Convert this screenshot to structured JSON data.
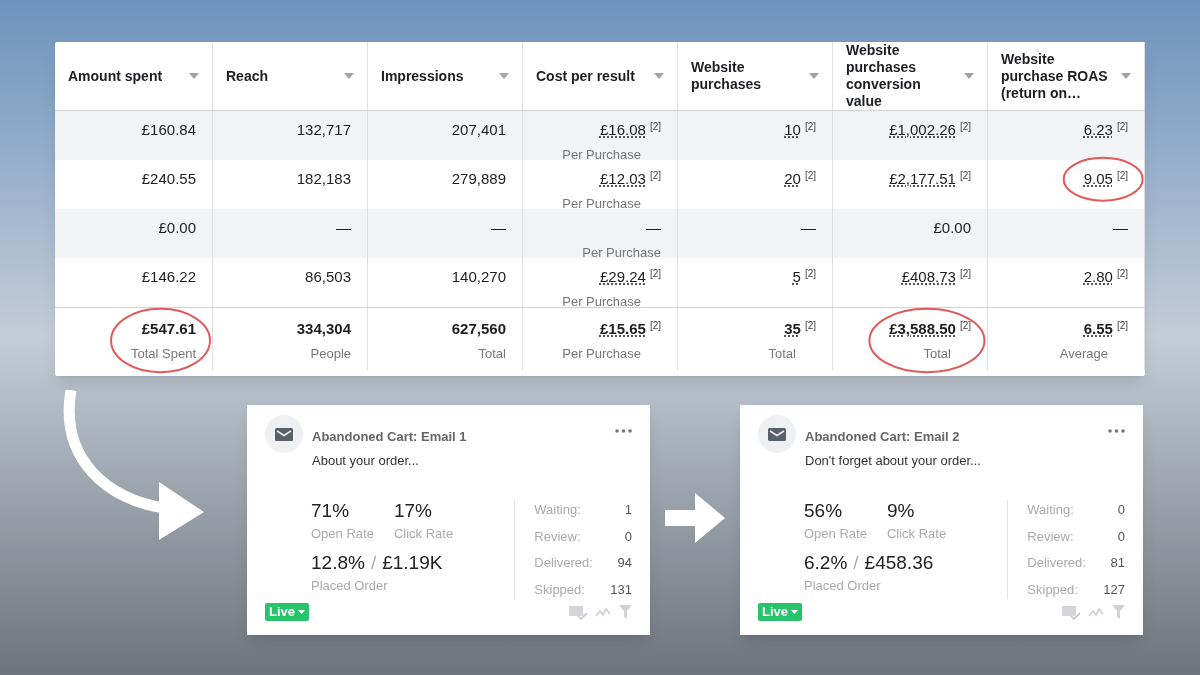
{
  "table": {
    "columns": [
      "Amount spent",
      "Reach",
      "Impressions",
      "Cost per result",
      "Website purchases",
      "Website purchases conversion value",
      "Website purchase ROAS (return on…"
    ],
    "rows": [
      {
        "cells": [
          {
            "value": "£160.84",
            "circled": false
          },
          {
            "value": "132,717",
            "circled": false
          },
          {
            "value": "207,401",
            "circled": false
          },
          {
            "value": "£16.08",
            "note": "[2]",
            "sub": "Per Purchase",
            "circled": false
          },
          {
            "value": "10",
            "note": "[2]",
            "circled": false
          },
          {
            "value": "£1,002.26",
            "note": "[2]",
            "circled": false
          },
          {
            "value": "6.23",
            "note": "[2]",
            "circled": false
          }
        ]
      },
      {
        "cells": [
          {
            "value": "£240.55",
            "circled": false
          },
          {
            "value": "182,183",
            "circled": false
          },
          {
            "value": "279,889",
            "circled": false
          },
          {
            "value": "£12.03",
            "note": "[2]",
            "sub": "Per Purchase",
            "circled": false
          },
          {
            "value": "20",
            "note": "[2]",
            "circled": false
          },
          {
            "value": "£2,177.51",
            "note": "[2]",
            "circled": false
          },
          {
            "value": "9.05",
            "note": "[2]",
            "circled": true
          }
        ]
      },
      {
        "cells": [
          {
            "value": "£0.00",
            "circled": false
          },
          {
            "value": "—",
            "circled": false
          },
          {
            "value": "—",
            "circled": false
          },
          {
            "value": "—",
            "sub": "Per Purchase",
            "circled": false
          },
          {
            "value": "—",
            "circled": false
          },
          {
            "value": "£0.00",
            "circled": false
          },
          {
            "value": "—",
            "circled": false
          }
        ]
      },
      {
        "cells": [
          {
            "value": "£146.22",
            "circled": false
          },
          {
            "value": "86,503",
            "circled": false
          },
          {
            "value": "140,270",
            "circled": false
          },
          {
            "value": "£29.24",
            "note": "[2]",
            "sub": "Per Purchase",
            "circled": false
          },
          {
            "value": "5",
            "note": "[2]",
            "circled": false
          },
          {
            "value": "£408.73",
            "note": "[2]",
            "circled": false
          },
          {
            "value": "2.80",
            "note": "[2]",
            "circled": false
          }
        ]
      }
    ],
    "totals": [
      {
        "value": "£547.61",
        "sub": "Total Spent",
        "circled": true
      },
      {
        "value": "334,304",
        "sub": "People",
        "circled": false
      },
      {
        "value": "627,560",
        "sub": "Total",
        "circled": false
      },
      {
        "value": "£15.65",
        "note": "[2]",
        "sub": "Per Purchase",
        "circled": false
      },
      {
        "value": "35",
        "note": "[2]",
        "sub": "Total",
        "circled": false
      },
      {
        "value": "£3,588.50",
        "note": "[2]",
        "sub": "Total",
        "circled": true
      },
      {
        "value": "6.55",
        "note": "[2]",
        "sub": "Average",
        "circled": false
      }
    ]
  },
  "cards": [
    {
      "title": "Abandoned Cart: Email 1",
      "subject": "About your order...",
      "open_rate": {
        "value": "71%",
        "label": "Open Rate"
      },
      "click_rate": {
        "value": "17%",
        "label": "Click Rate"
      },
      "placed_order": {
        "rate": "12.8%",
        "separator": "/",
        "revenue": "£1.19K",
        "label": "Placed Order"
      },
      "counts": [
        {
          "label": "Waiting:",
          "value": "1"
        },
        {
          "label": "Review:",
          "value": "0"
        },
        {
          "label": "Delivered:",
          "value": "94"
        },
        {
          "label": "Skipped:",
          "value": "131"
        }
      ],
      "status": "Live"
    },
    {
      "title": "Abandoned Cart: Email 2",
      "subject": "Don't forget about your order...",
      "open_rate": {
        "value": "56%",
        "label": "Open Rate"
      },
      "click_rate": {
        "value": "9%",
        "label": "Click Rate"
      },
      "placed_order": {
        "rate": "6.2%",
        "separator": "/",
        "revenue": "£458.36",
        "label": "Placed Order"
      },
      "counts": [
        {
          "label": "Waiting:",
          "value": "0"
        },
        {
          "label": "Review:",
          "value": "0"
        },
        {
          "label": "Delivered:",
          "value": "81"
        },
        {
          "label": "Skipped:",
          "value": "127"
        }
      ],
      "status": "Live"
    }
  ]
}
